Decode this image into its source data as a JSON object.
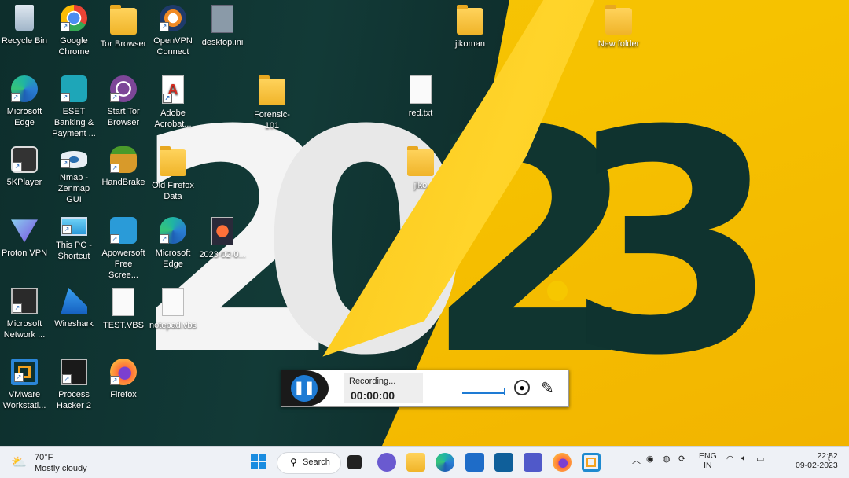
{
  "desktop": {
    "icons": [
      {
        "label": "Recycle Bin"
      },
      {
        "label": "Google Chrome"
      },
      {
        "label": "Tor Browser"
      },
      {
        "label": "OpenVPN Connect"
      },
      {
        "label": "desktop.ini"
      },
      {
        "label": "jikoman"
      },
      {
        "label": "New folder"
      },
      {
        "label": "Microsoft Edge"
      },
      {
        "label": "ESET Banking & Payment ..."
      },
      {
        "label": "Start Tor Browser"
      },
      {
        "label": "Adobe Acrobat..."
      },
      {
        "label": "Forensic-101"
      },
      {
        "label": "red.txt"
      },
      {
        "label": "5KPlayer"
      },
      {
        "label": "Nmap - Zenmap GUI"
      },
      {
        "label": "HandBrake"
      },
      {
        "label": "Old Firefox Data"
      },
      {
        "label": "jiko"
      },
      {
        "label": "Proton VPN"
      },
      {
        "label": "This PC - Shortcut"
      },
      {
        "label": "Apowersoft Free Scree..."
      },
      {
        "label": "Microsoft Edge"
      },
      {
        "label": "2023-02-0..."
      },
      {
        "label": "Microsoft Network ..."
      },
      {
        "label": "Wireshark"
      },
      {
        "label": "TEST.VBS"
      },
      {
        "label": "notepad.vbs"
      },
      {
        "label": "VMware Workstati..."
      },
      {
        "label": "Process Hacker 2"
      },
      {
        "label": "Firefox"
      }
    ],
    "wallpaper_digits": [
      "2",
      "0",
      "2",
      "3"
    ]
  },
  "recorder": {
    "status": "Recording...",
    "time": "00:00:00",
    "pause_icon": "pause-icon"
  },
  "taskbar": {
    "weather_temp": "70°F",
    "weather_cond": "Mostly cloudy",
    "search_label": "Search",
    "lang_line1": "ENG",
    "lang_line2": "IN",
    "time": "22:52",
    "date": "09-02-2023"
  }
}
